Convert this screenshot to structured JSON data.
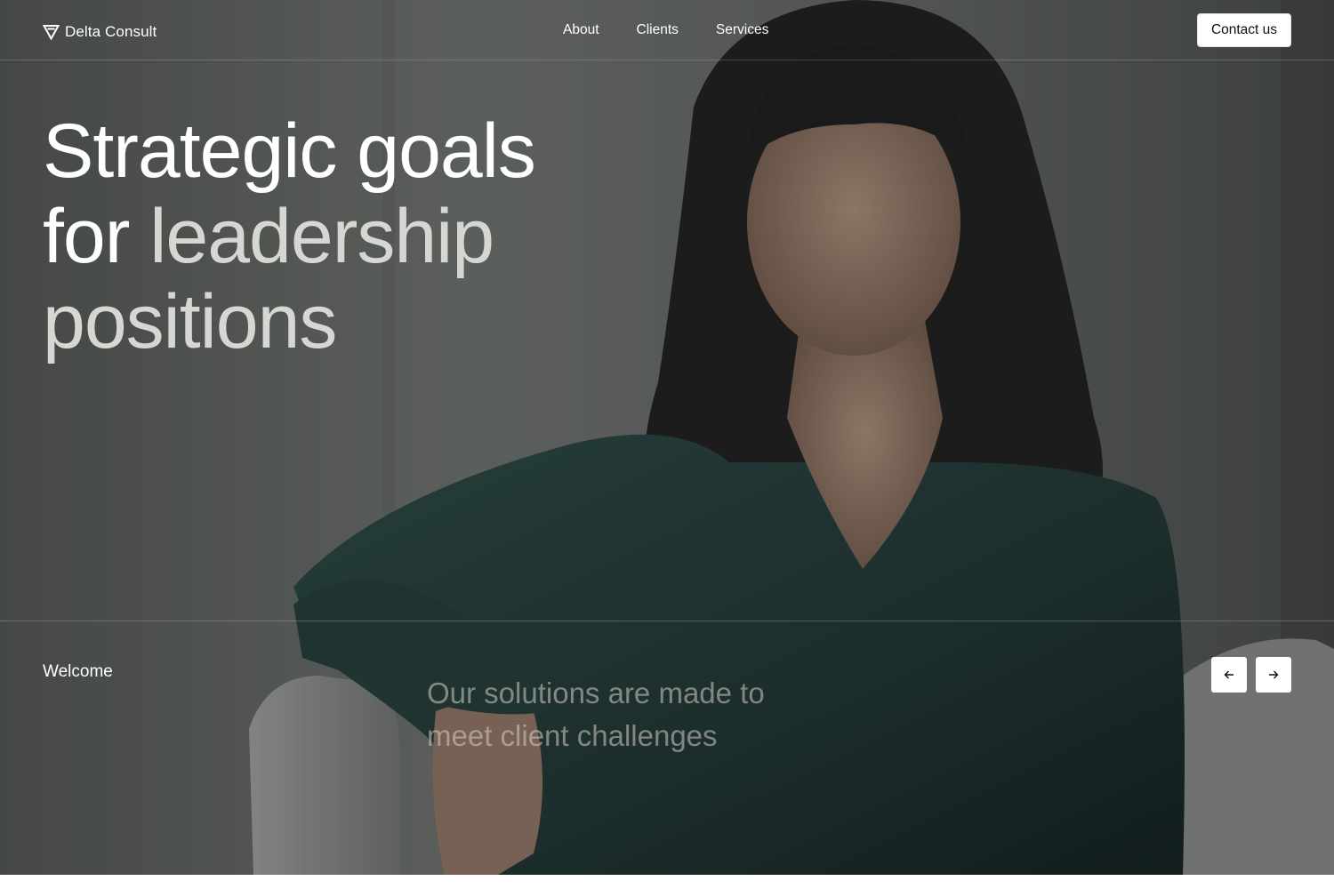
{
  "brand": {
    "logo_icon": "delta-triangle-icon",
    "name": "Delta Consult"
  },
  "nav": {
    "links": [
      "About",
      "Clients",
      "Services"
    ],
    "cta_label": "Contact us"
  },
  "hero": {
    "headline_line1": "Strategic goals",
    "headline_line2_word1": "for",
    "headline_line2_word2": "leadership",
    "headline_line3": "positions",
    "welcome": "Welcome",
    "tagline": "Our solutions are made to meet client challenges",
    "prev_icon": "arrow-left-icon",
    "next_icon": "arrow-right-icon"
  },
  "colors": {
    "text_primary": "#ffffff",
    "text_muted": "#d6d6d3",
    "shirt": "#1f3533",
    "background_wall": "#5a5e5b"
  }
}
